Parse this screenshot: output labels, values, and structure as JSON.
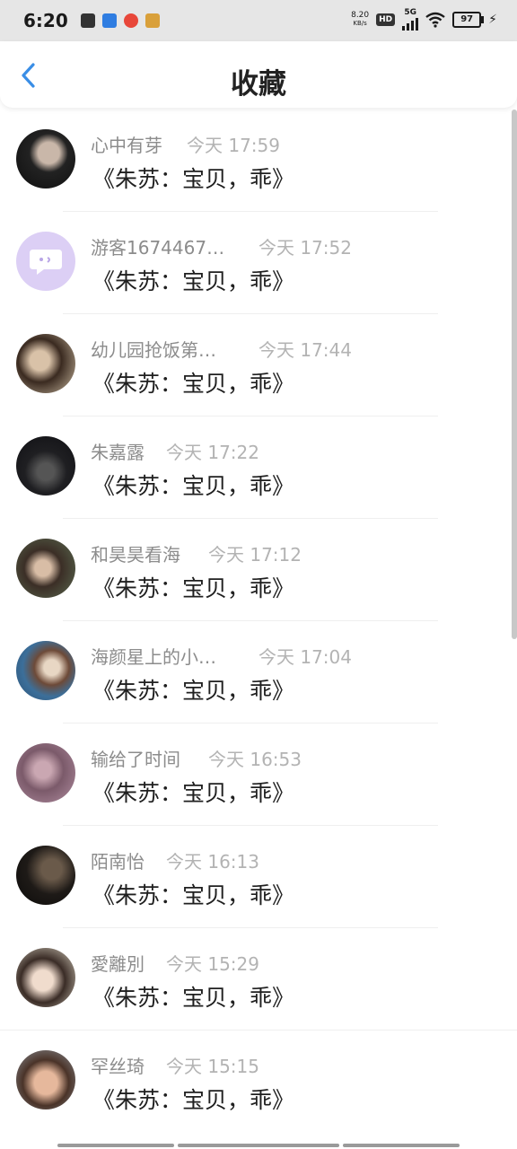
{
  "status": {
    "time": "6:20",
    "net_speed_value": "8.20",
    "net_speed_unit": "KB/s",
    "hd": "HD",
    "network": "5G",
    "battery": "97"
  },
  "header": {
    "title": "收藏"
  },
  "items": [
    {
      "name": "心中有芽",
      "time": "今天 17:59",
      "title": "《朱苏：宝贝，乖》"
    },
    {
      "name": "游客1674467…",
      "time": "今天 17:52",
      "title": "《朱苏：宝贝，乖》"
    },
    {
      "name": "幼儿园抢饭第…",
      "time": "今天 17:44",
      "title": "《朱苏：宝贝，乖》"
    },
    {
      "name": "朱嘉露",
      "time": "今天 17:22",
      "title": "《朱苏：宝贝，乖》"
    },
    {
      "name": "和昊昊看海",
      "time": "今天 17:12",
      "title": "《朱苏：宝贝，乖》"
    },
    {
      "name": "海颜星上的小…",
      "time": "今天 17:04",
      "title": "《朱苏：宝贝，乖》"
    },
    {
      "name": "输给了时间",
      "time": "今天 16:53",
      "title": "《朱苏：宝贝，乖》"
    },
    {
      "name": "陌南怡",
      "time": "今天 16:13",
      "title": "《朱苏：宝贝，乖》"
    },
    {
      "name": "愛離別",
      "time": "今天 15:29",
      "title": "《朱苏：宝贝，乖》"
    },
    {
      "name": "罕丝琦",
      "time": "今天 15:15",
      "title": "《朱苏：宝贝，乖》"
    }
  ],
  "colors": {
    "accent": "#3a8ee6",
    "name": "#8c8c8c",
    "time": "#b3b3b3"
  }
}
